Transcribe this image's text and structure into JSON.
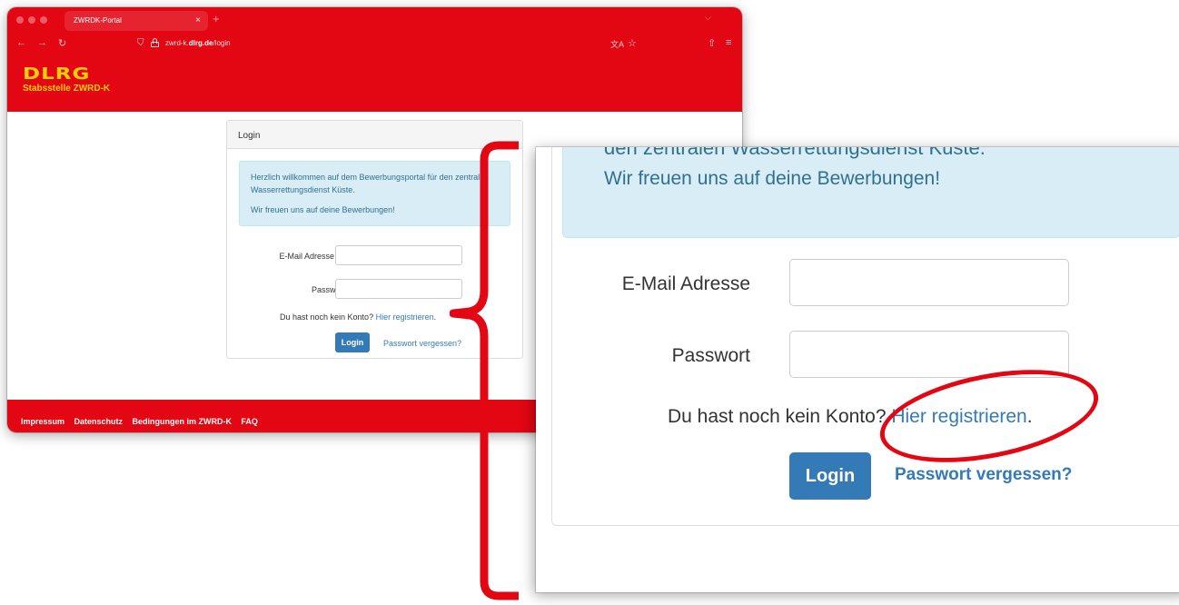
{
  "browser": {
    "tab_title": "ZWRDK-Portal",
    "tab_close": "×",
    "new_tab": "+",
    "url_prefix": "zwrd-k.",
    "url_domain": "dlrg.de",
    "url_path": "/login"
  },
  "site": {
    "logo_word": "DLRG",
    "logo_sub": "Stabsstelle ZWRD-K"
  },
  "login": {
    "heading": "Login",
    "welcome": "Herzlich willkommen auf dem Bewerbungsportal für den zentralen Wasserrettungsdienst Küste.",
    "welcome_cut": "den zentralen Wasserrettungsdienst Küste.",
    "applications": "Wir freuen uns auf deine Bewerbungen!",
    "email_label": "E-Mail Adresse",
    "password_label": "Passwort",
    "no_account": "Du hast noch kein Konto?",
    "register_link": "Hier registrieren",
    "register_dot": ".",
    "login_button": "Login",
    "forgot_link": "Passwort vergessen?"
  },
  "footer": {
    "links": [
      "Impressum",
      "Datenschutz",
      "Bedingungen im ZWRD-K",
      "FAQ"
    ]
  },
  "colors": {
    "brand_red": "#e30613",
    "logo_yellow": "#ffd100",
    "link_blue": "#337ab7",
    "alert_bg": "#d9edf7"
  }
}
